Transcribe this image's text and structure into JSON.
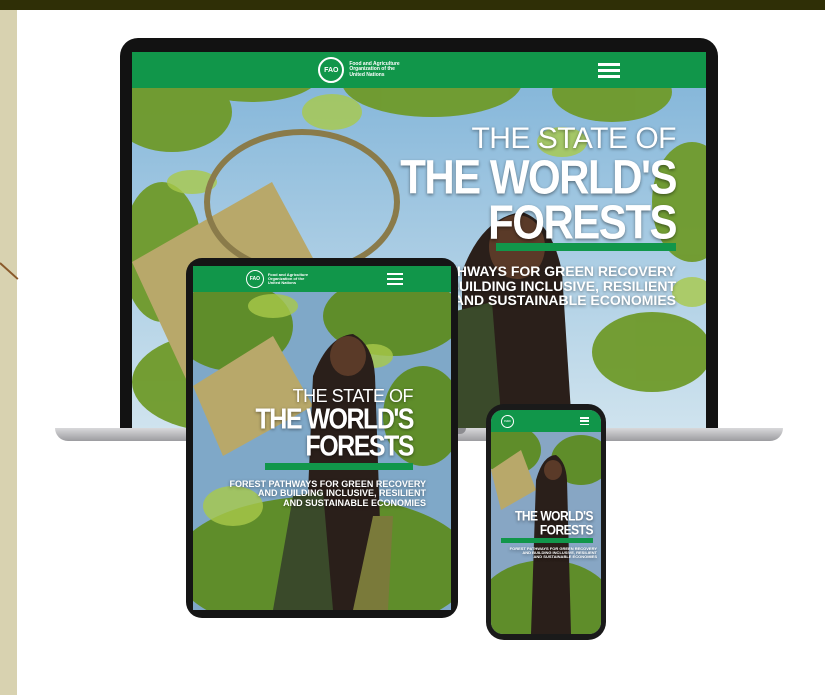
{
  "colors": {
    "brand_green": "#11964a",
    "frame_dark": "#2f2f06",
    "frame_side": "#d8d2b0"
  },
  "org": {
    "name": "Food and Agriculture\nOrganization of the\nUnited Nations",
    "emblem": "FAO"
  },
  "title": {
    "line1": "THE STATE OF",
    "line2": "THE WORLD'S",
    "line3": "FORESTS"
  },
  "subtitle": {
    "laptop": "PATHWAYS FOR GREEN RECOVERY\nBUILDING INCLUSIVE, RESILIENT\nAND SUSTAINABLE ECONOMIES",
    "tablet": "FOREST PATHWAYS FOR GREEN RECOVERY\nAND BUILDING INCLUSIVE, RESILIENT\nAND SUSTAINABLE ECONOMIES"
  },
  "icons": {
    "menu": "hamburger-menu-icon",
    "emblem": "fao-logo-icon"
  }
}
